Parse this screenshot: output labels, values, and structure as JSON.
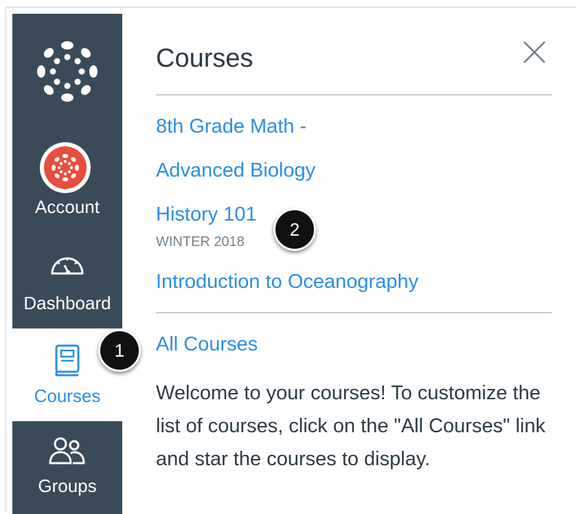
{
  "nav": {
    "logo_icon": "canvas-logo-icon",
    "items": [
      {
        "label": "Account",
        "icon": "account-avatar-icon"
      },
      {
        "label": "Dashboard",
        "icon": "dashboard-icon"
      },
      {
        "label": "Courses",
        "icon": "courses-book-icon",
        "active": true
      },
      {
        "label": "Groups",
        "icon": "groups-icon"
      }
    ],
    "colors": {
      "background": "#394b58",
      "active_text": "#2b8ee6"
    }
  },
  "tray": {
    "title": "Courses",
    "close_icon": "close-icon",
    "courses": [
      {
        "name": "8th Grade Math -"
      },
      {
        "name": "Advanced Biology"
      },
      {
        "name": "History 101",
        "term": "WINTER 2018"
      },
      {
        "name": "Introduction to Oceanography"
      }
    ],
    "all_courses_link": "All Courses",
    "welcome_text": "Welcome to your courses! To customize the list of courses, click on the \"All Courses\" link and star the courses to display.",
    "link_color": "#2b8ee6"
  },
  "callouts": [
    "1",
    "2"
  ]
}
